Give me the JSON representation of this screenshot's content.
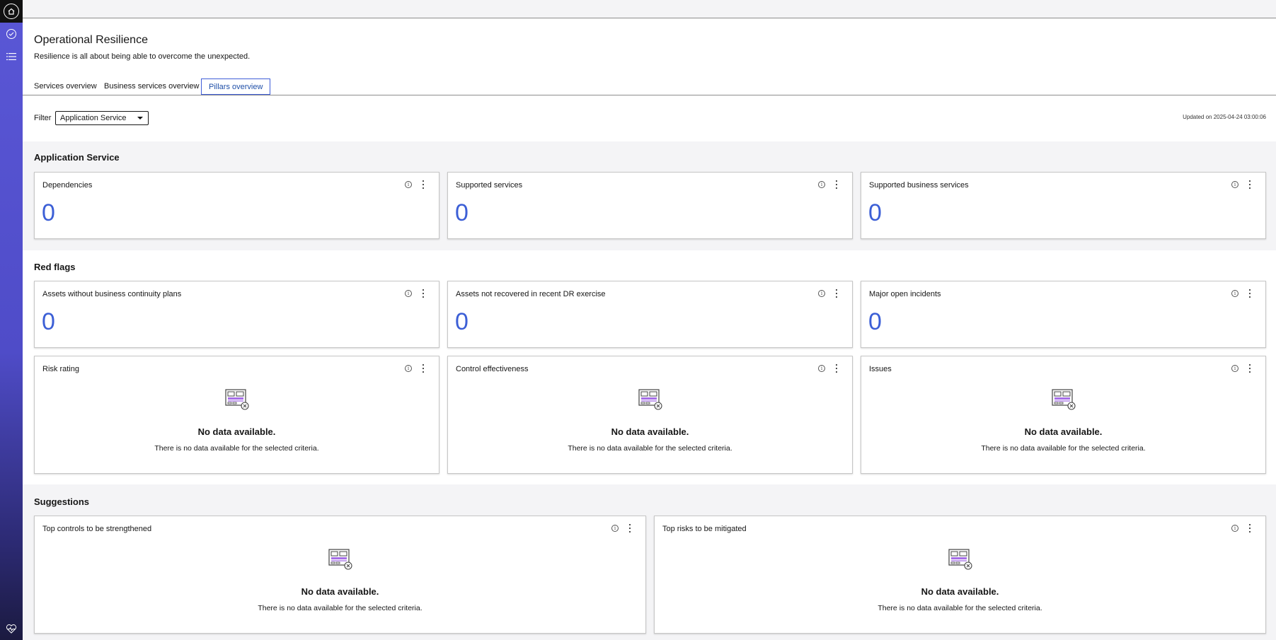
{
  "sidebar": {
    "icons": [
      "home-icon",
      "check-circle-icon",
      "list-icon",
      "health-icon"
    ]
  },
  "header": {
    "title": "Operational Resilience",
    "subtitle": "Resilience is all about being able to overcome the unexpected."
  },
  "tabs": [
    {
      "label": "Services overview",
      "active": false
    },
    {
      "label": "Business services overview",
      "active": false
    },
    {
      "label": "Pillars overview",
      "active": true
    }
  ],
  "filter": {
    "label": "Filter",
    "value": "Application Service"
  },
  "updated": "Updated on 2025-04-24 03:00:06",
  "info_glyph": "i",
  "no_data": {
    "title": "No data available.",
    "text": "There is no data available for the selected criteria."
  },
  "sections": {
    "application_service": {
      "title": "Application Service",
      "cards": [
        {
          "title": "Dependencies",
          "value": "0"
        },
        {
          "title": "Supported services",
          "value": "0"
        },
        {
          "title": "Supported business services",
          "value": "0"
        }
      ]
    },
    "red_flags": {
      "title": "Red flags",
      "cards": [
        {
          "title": "Assets without business continuity plans",
          "value": "0"
        },
        {
          "title": "Assets not recovered in recent DR exercise",
          "value": "0"
        },
        {
          "title": "Major open incidents",
          "value": "0"
        }
      ],
      "empty_cards": [
        {
          "title": "Risk rating"
        },
        {
          "title": "Control effectiveness"
        },
        {
          "title": "Issues"
        }
      ]
    },
    "suggestions": {
      "title": "Suggestions",
      "empty_cards": [
        {
          "title": "Top controls to be strengthened"
        },
        {
          "title": "Top risks to be mitigated"
        }
      ]
    }
  },
  "colors": {
    "accent_value": "#3c5fd6",
    "sidebar": "#5a57d6",
    "tab_active_border": "#3f5ed8"
  }
}
